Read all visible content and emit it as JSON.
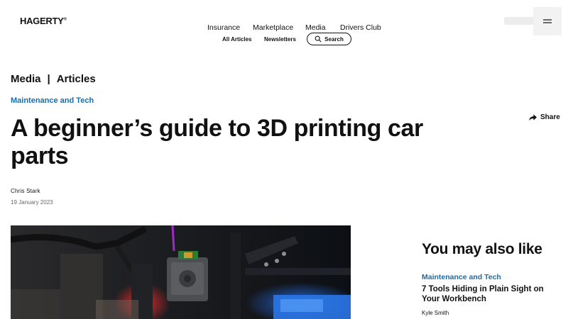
{
  "header": {
    "logo_text": "HAGERTY",
    "nav": [
      "Insurance",
      "Marketplace",
      "Media",
      "Drivers Club"
    ],
    "subnav": [
      "All Articles",
      "Newsletters"
    ],
    "search_label": "Search"
  },
  "breadcrumb": {
    "section": "Media",
    "separator": "|",
    "page": "Articles"
  },
  "article": {
    "category": "Maintenance and Tech",
    "title": "A beginner’s guide to 3D printing car parts",
    "author": "Chris Stark",
    "date": "19 January 2023",
    "share_label": "Share"
  },
  "related": {
    "heading": "You may also like",
    "items": [
      {
        "category": "Maintenance and Tech",
        "title": "7 Tools Hiding in Plain Sight on Your Workbench",
        "author": "Kyle Smith"
      }
    ]
  },
  "colors": {
    "accent": "#1a6ca8",
    "text": "#111111"
  }
}
